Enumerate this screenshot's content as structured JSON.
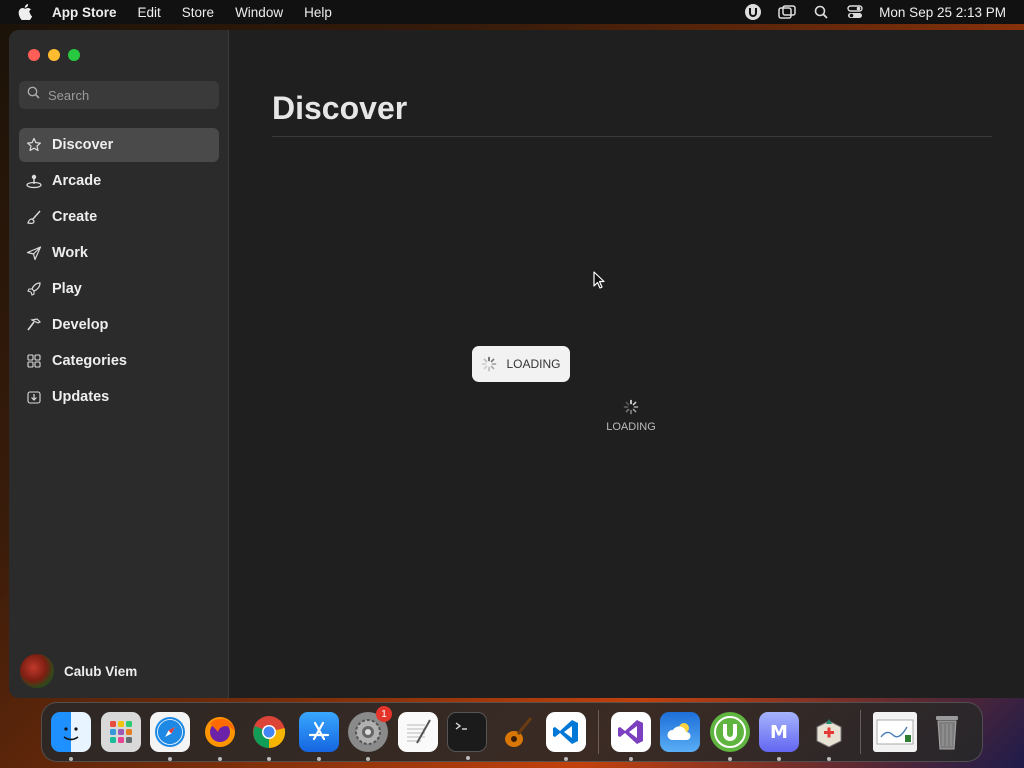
{
  "menubar": {
    "app_name": "App Store",
    "items": [
      "Edit",
      "Store",
      "Window",
      "Help"
    ],
    "clock": "Mon Sep 25  2:13 PM"
  },
  "sidebar": {
    "search_placeholder": "Search",
    "items": [
      {
        "label": "Discover",
        "icon": "star-icon",
        "active": true
      },
      {
        "label": "Arcade",
        "icon": "joystick-icon"
      },
      {
        "label": "Create",
        "icon": "brush-icon"
      },
      {
        "label": "Work",
        "icon": "paper-plane-icon"
      },
      {
        "label": "Play",
        "icon": "rocket-icon"
      },
      {
        "label": "Develop",
        "icon": "hammer-icon"
      },
      {
        "label": "Categories",
        "icon": "grid-icon"
      },
      {
        "label": "Updates",
        "icon": "download-icon"
      }
    ],
    "user_name": "Calub Viem"
  },
  "main": {
    "title": "Discover",
    "loading_pill_text": "LOADING",
    "loading_text": "LOADING"
  },
  "dock": {
    "apps": [
      "finder-icon",
      "launchpad-icon",
      "safari-icon",
      "firefox-icon",
      "chrome-icon",
      "app-store-icon",
      "system-settings-icon",
      "textedit-icon",
      "terminal-icon",
      "garageband-icon",
      "vscode-icon",
      "visual-studio-icon",
      "weather-icon",
      "utorrent-icon",
      "m-app-icon",
      "installer-icon",
      "preview-icon",
      "trash-icon"
    ],
    "settings_badge": "1"
  },
  "colors": {
    "accent_red": "#ff5f57",
    "accent_yellow": "#febc2e",
    "accent_green": "#28c840",
    "sidebar_bg": "#2b2b2b",
    "main_bg": "#1f1f1f"
  }
}
